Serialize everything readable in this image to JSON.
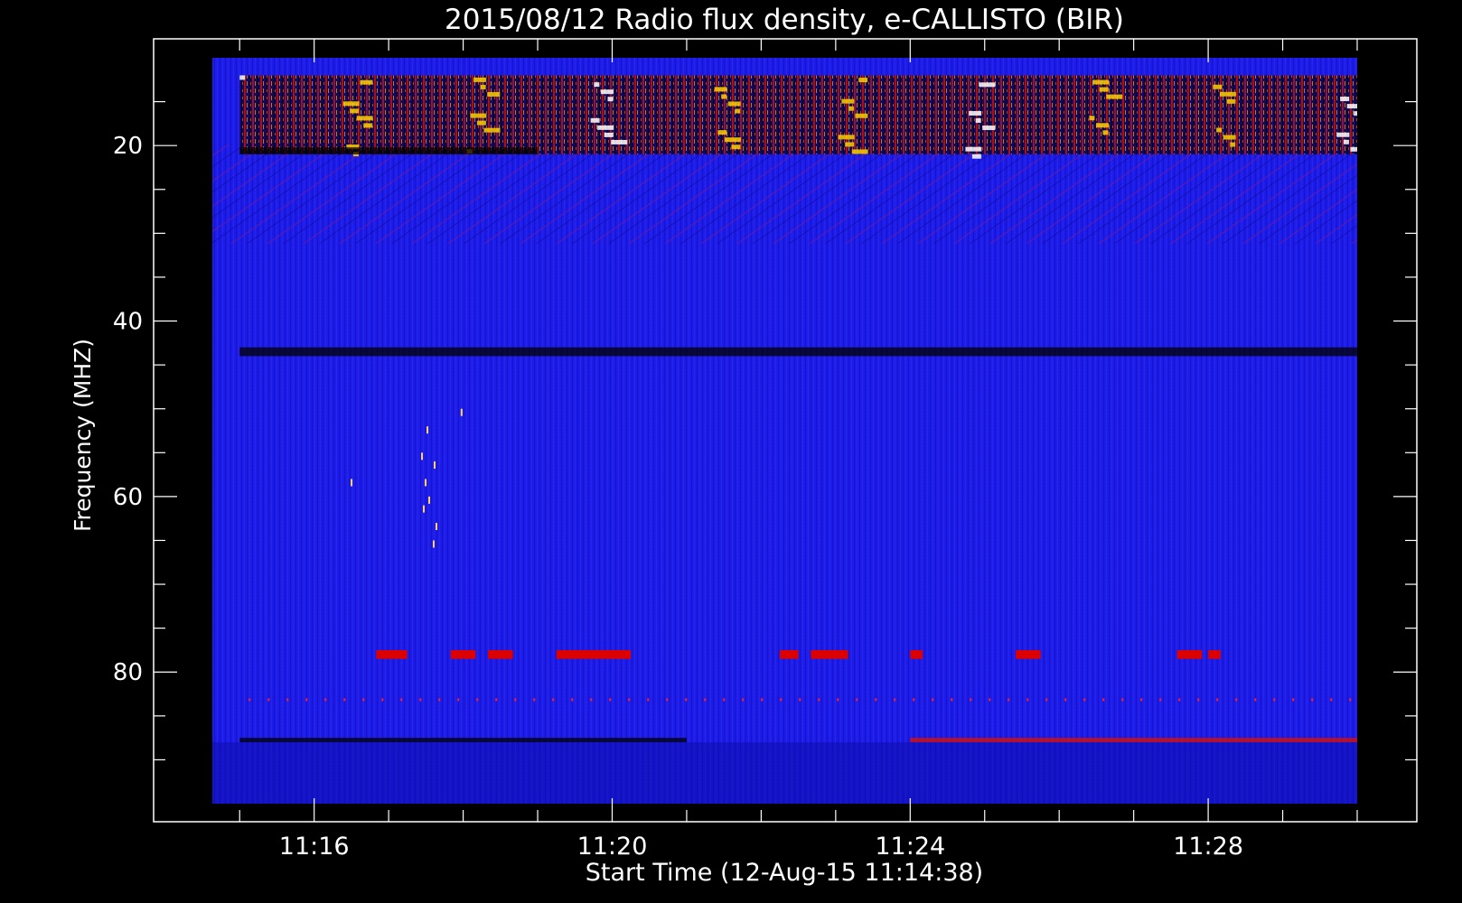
{
  "chart_data": {
    "type": "heatmap",
    "title": "2015/08/12  Radio flux density, e-CALLISTO (BIR)",
    "xlabel": "Start Time (12-Aug-15 11:14:38)",
    "ylabel": "Frequency (MHZ)",
    "x_unit": "minutes",
    "xlim": [
      "11:14:38",
      "11:30:00"
    ],
    "ylim": [
      10,
      95
    ],
    "y_inverted": true,
    "x_ticks": [
      "11:16",
      "11:20",
      "11:24",
      "11:28"
    ],
    "y_ticks": [
      20,
      40,
      60,
      80
    ],
    "colormap": [
      "#000000",
      "#0000ff",
      "#ff0000",
      "#ffff00",
      "#ffffff"
    ],
    "background_color": "#1a1ae6",
    "features": [
      {
        "label": "strong RFI band (intermittent, yellow/white)",
        "freq_range": [
          12,
          21
        ],
        "time_range": [
          "11:15:00",
          "11:30:00"
        ],
        "level": "high"
      },
      {
        "label": "black low-response line",
        "freq_range": [
          20.2,
          21
        ],
        "time_range": [
          "11:15:00",
          "11:19:00"
        ],
        "level": "low"
      },
      {
        "label": "diagonal striations",
        "freq_range": [
          20,
          32
        ],
        "time_range": [
          "11:15:00",
          "11:30:00"
        ],
        "level": "medium"
      },
      {
        "label": "dark horizontal line",
        "freq_range": [
          43,
          44
        ],
        "time_range": [
          "11:15:00",
          "11:30:00"
        ],
        "level": "low"
      },
      {
        "label": "red bursts near 78 MHz",
        "freq_range": [
          77.5,
          78.5
        ],
        "time_range": [
          "11:16:50",
          "11:28:10"
        ],
        "level": "high"
      },
      {
        "label": "dotted red line near 83 MHz",
        "freq_range": [
          83,
          83.4
        ],
        "time_range": [
          "11:15:00",
          "11:30:00"
        ],
        "level": "medium"
      },
      {
        "label": "black band near 88 MHz",
        "freq_range": [
          87.5,
          88
        ],
        "time_range": [
          "11:15:00",
          "11:21:00"
        ],
        "level": "low"
      },
      {
        "label": "red band near 88 MHz",
        "freq_range": [
          87.5,
          88
        ],
        "time_range": [
          "11:24:00",
          "11:30:00"
        ],
        "level": "high"
      },
      {
        "label": "scattered short bursts",
        "freq_range": [
          50,
          66
        ],
        "time_range": [
          "11:17:50",
          "11:18:10"
        ],
        "level": "high"
      }
    ],
    "grid": false,
    "legend": "none"
  }
}
